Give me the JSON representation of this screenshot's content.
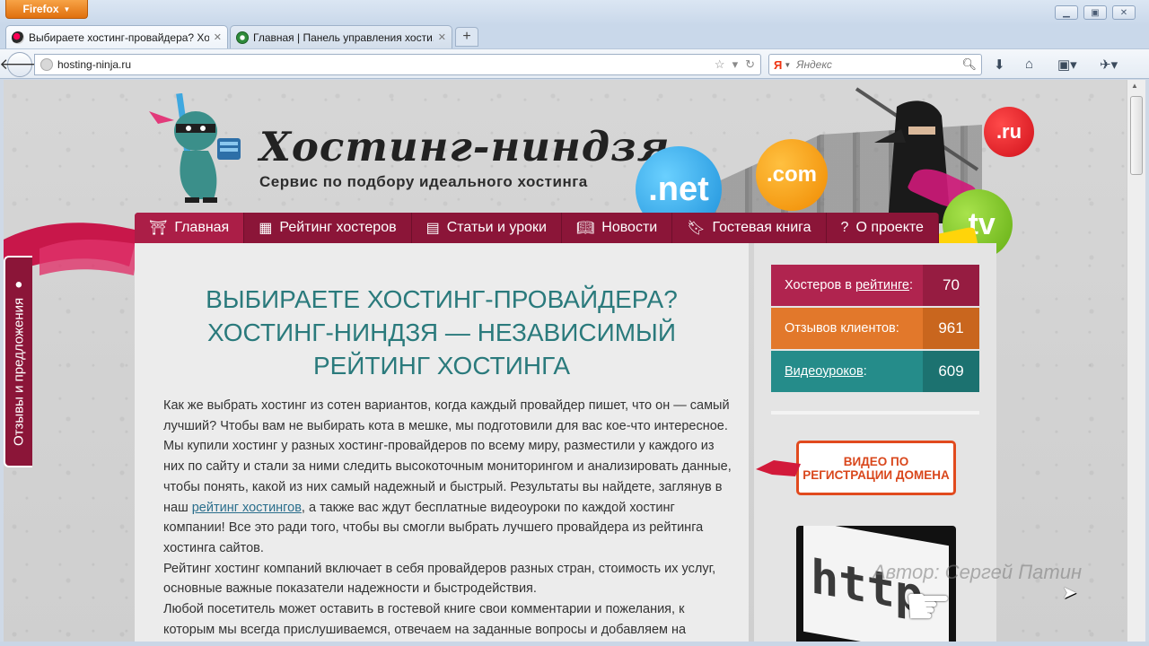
{
  "browser": {
    "app_button": "Firefox",
    "tabs": [
      {
        "title": "Выбираете хостинг-провайдера? Хо...",
        "active": true
      },
      {
        "title": "Главная | Панель управления хости...",
        "active": false
      }
    ],
    "url": "hosting-ninja.ru",
    "search_placeholder": "Яндекс",
    "search_engine_logo": "Я"
  },
  "header": {
    "title": "Хостинг-ниндзя",
    "subtitle": "Сервис по подбору идеального хостинга",
    "domain_bubbles": [
      ".net",
      ".com",
      ".ru",
      ".tv"
    ]
  },
  "nav": {
    "items": [
      {
        "label": "Главная",
        "icon": "temple-icon"
      },
      {
        "label": "Рейтинг хостеров",
        "icon": "rating-icon"
      },
      {
        "label": "Статьи и уроки",
        "icon": "articles-icon"
      },
      {
        "label": "Новости",
        "icon": "news-icon"
      },
      {
        "label": "Гостевая книга",
        "icon": "guestbook-icon"
      },
      {
        "label": "О проекте",
        "icon": "question-icon"
      }
    ]
  },
  "feedback_tab": "Отзывы и предложения",
  "main": {
    "heading": "ВЫБИРАЕТЕ ХОСТИНГ-ПРОВАЙДЕРА? ХОСТИНГ-НИНДЗЯ — НЕЗАВИСИМЫЙ РЕЙТИНГ ХОСТИНГА",
    "p1_before_link": "Как же выбрать хостинг из сотен вариантов, когда каждый провайдер пишет, что он — самый лучший? Чтобы вам не выбирать кота в мешке, мы подготовили для вас кое-что интересное. Мы купили хостинг у разных хостинг-провайдеров по всему миру, разместили у каждого из них по сайту и стали за ними следить высокоточным мониторингом и анализировать данные, чтобы понять, какой из них самый надежный и быстрый. Результаты вы найдете, заглянув в наш ",
    "p1_link": "рейтинг хостингов",
    "p1_after_link": ", а также вас ждут бесплатные видеоуроки по каждой хостинг компании! Все это ради того, чтобы вы смогли выбрать лучшего провайдера из рейтинга хостинга сайтов.",
    "p2": "Рейтинг хостинг компаний включает в себя провайдеров разных стран, стоимость их услуг, основные важные показатели надежности и быстродействия.",
    "p3": "Любой посетитель может оставить в гостевой книге свои комментарии и пожелания, к которым мы всегда прислушиваемся, отвечаем на заданные вопросы и добавляем на"
  },
  "sidebar": {
    "stats": [
      {
        "label_prefix": "Хостеров в ",
        "label_link": "рейтинге",
        "label_suffix": ":",
        "value": "70",
        "color": "#b0244f"
      },
      {
        "label_prefix": "Отзывов клиентов:",
        "label_link": "",
        "label_suffix": "",
        "value": "961",
        "color": "#e2782b"
      },
      {
        "label_prefix": "",
        "label_link": "Видеоуроков",
        "label_suffix": ":",
        "value": "609",
        "color": "#258c8a"
      }
    ],
    "video_button": "ВИДЕО ПО РЕГИСТРАЦИИ ДОМЕНА",
    "banner_text": "http"
  },
  "watermark": "Автор: Сергей Патин",
  "colors": {
    "nav_bg": "#8b1538",
    "heading": "#2a7a7c",
    "accent_orange": "#e14a1e"
  }
}
